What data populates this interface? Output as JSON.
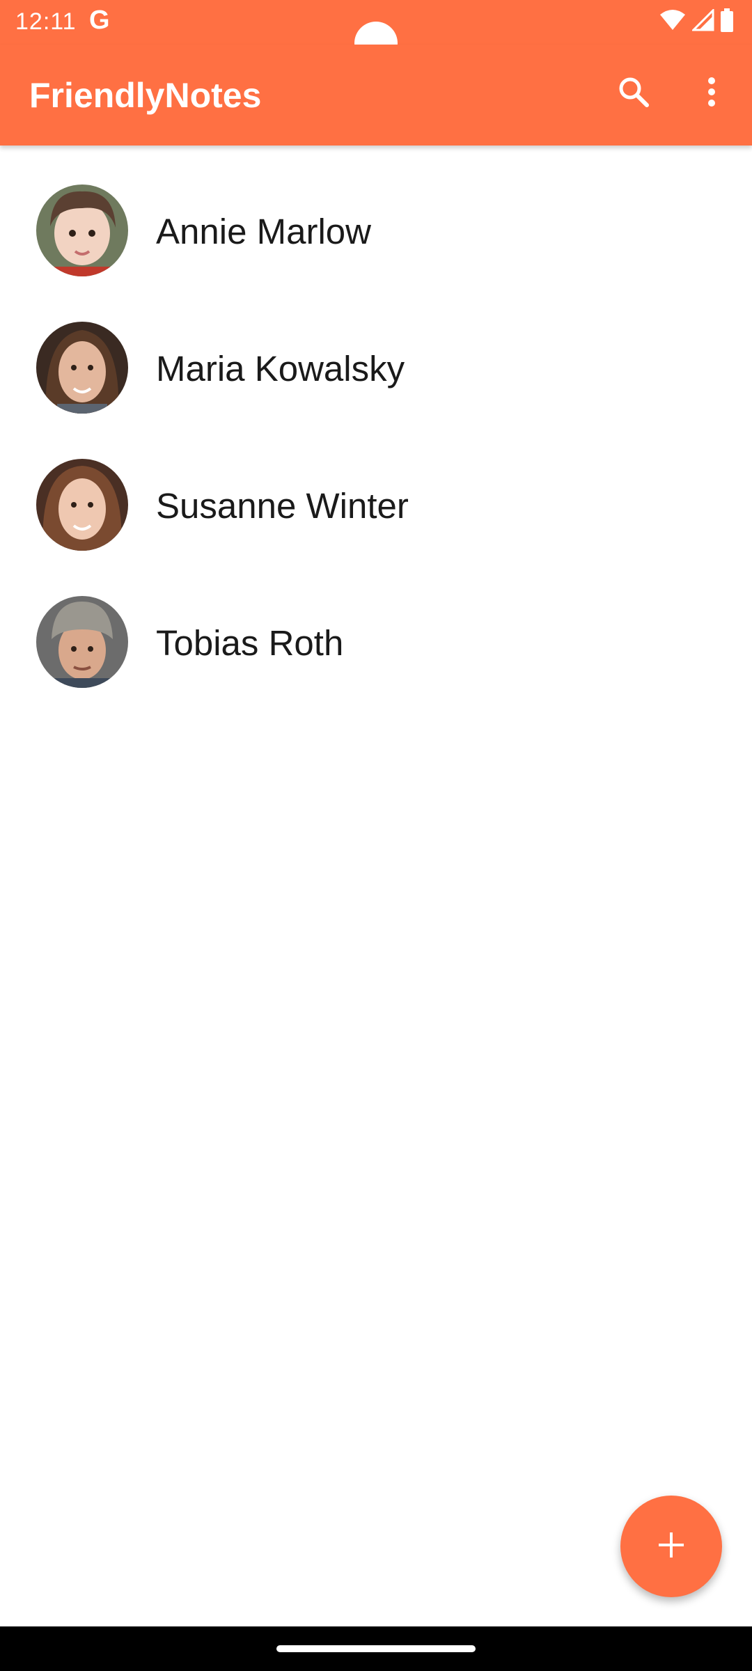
{
  "status_bar": {
    "time": "12:11",
    "google_glyph": "G",
    "icons": [
      "wifi-icon",
      "cell-signal-icon",
      "battery-icon"
    ]
  },
  "app_bar": {
    "title": "FriendlyNotes",
    "actions": [
      "search-icon",
      "more-vert-icon"
    ]
  },
  "contacts": [
    {
      "name": "Annie Marlow",
      "avatar": "child-portrait"
    },
    {
      "name": "Maria Kowalsky",
      "avatar": "woman-portrait"
    },
    {
      "name": "Susanne Winter",
      "avatar": "curly-woman-portrait"
    },
    {
      "name": "Tobias Roth",
      "avatar": "man-beanie-portrait"
    }
  ],
  "fab": {
    "icon": "add-icon"
  },
  "colors": {
    "accent": "#ff7043",
    "background": "#ffffff",
    "text": "#1a1a1a",
    "nav_bar": "#000000"
  }
}
